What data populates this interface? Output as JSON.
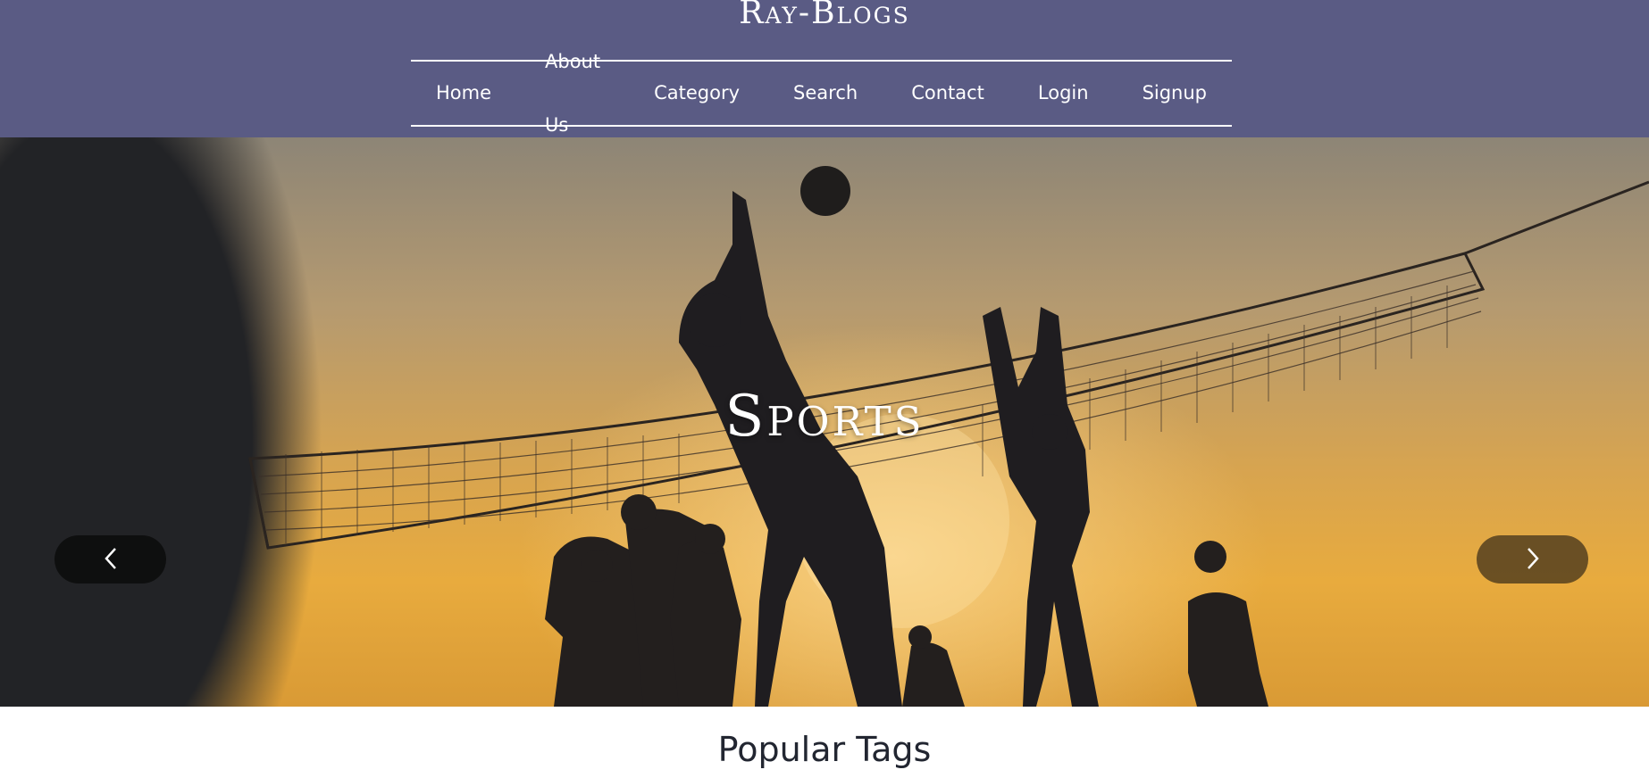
{
  "brand": {
    "title": "Ray-Blogs"
  },
  "nav": {
    "items": [
      {
        "label": "Home"
      },
      {
        "label": "About Us"
      },
      {
        "label": "Category"
      },
      {
        "label": "Search"
      },
      {
        "label": "Contact"
      },
      {
        "label": "Login"
      },
      {
        "label": "Signup"
      }
    ]
  },
  "carousel": {
    "caption": "Sports",
    "prev_icon": "chevron-left-icon",
    "next_icon": "chevron-right-icon"
  },
  "sections": {
    "popular_tags_title": "Popular Tags"
  },
  "colors": {
    "header_bg": "#5a5b84",
    "text_dark": "#222631",
    "white": "#ffffff"
  }
}
